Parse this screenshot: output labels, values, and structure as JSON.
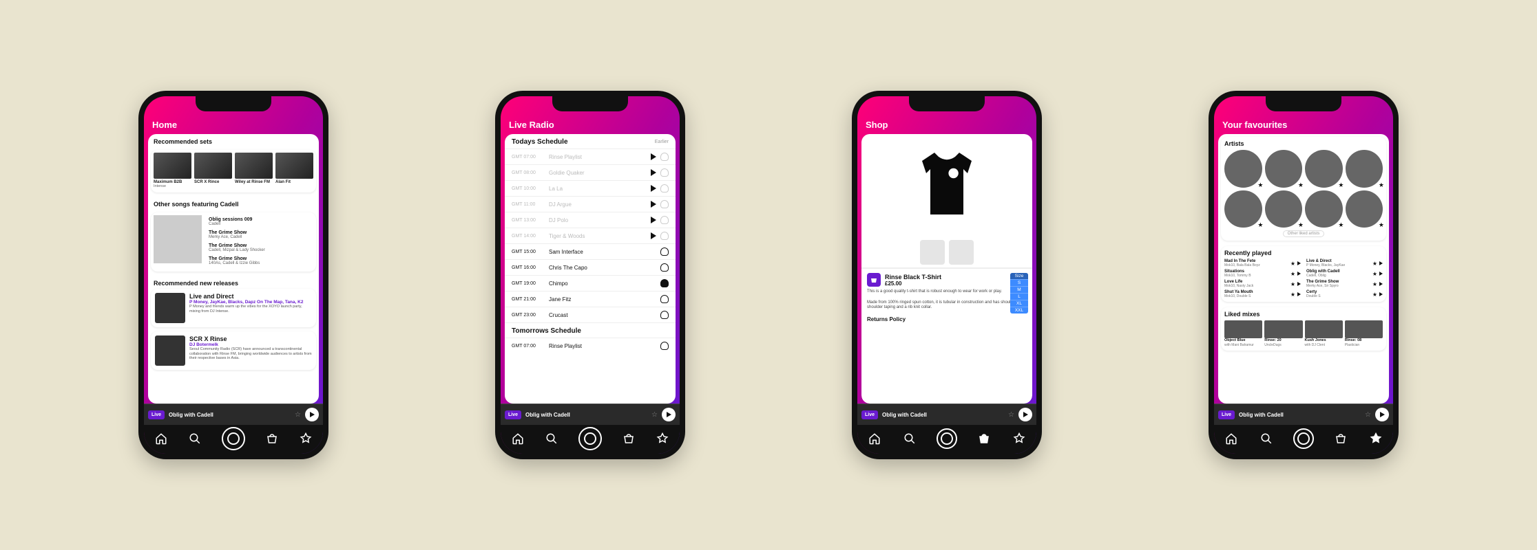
{
  "screens": {
    "home": {
      "title": "Home"
    },
    "radio": {
      "title": "Live Radio"
    },
    "shop": {
      "title": "Shop"
    },
    "favourites": {
      "title": "Your favourites"
    }
  },
  "home": {
    "recommended_heading": "Recommended sets",
    "sets": [
      {
        "label": "Maximum B2B",
        "sub": "Intense"
      },
      {
        "label": "SCR X Rince",
        "sub": ""
      },
      {
        "label": "Wiley at Rinse FM",
        "sub": ""
      },
      {
        "label": "Alan Fit",
        "sub": ""
      }
    ],
    "other_heading": "Other songs featuring Cadell",
    "other": [
      {
        "title": "Oblig sessions 009",
        "sub": "Cadell"
      },
      {
        "title": "The Grime Show",
        "sub": "Merky Ace, Cadell"
      },
      {
        "title": "The Grime Show",
        "sub": "Cadell, Mizpal & Lady Shocker"
      },
      {
        "title": "The Grime Show",
        "sub": "140As, Cadell & Izzie Gibbs"
      }
    ],
    "releases_heading": "Recommended new releases",
    "releases": [
      {
        "title": "Live and Direct",
        "sub": "P Money, JayKae, Blacks, Dapz On The Map, Tana, K2",
        "desc": "P Money and friends warm up the vibes for the XOYO launch party, mixing from DJ Intense."
      },
      {
        "title": "SCR X Rinse",
        "sub": "DJ Botermelk",
        "desc": "Seoul Community Radio (SCR) have announced a transcontinental collaboration with Rinse FM, bringing worldwide audiences to artists from their respective bases in Asia."
      }
    ]
  },
  "radio": {
    "today_heading": "Todays Schedule",
    "earlier_label": "Earlier",
    "tomorrow_heading": "Tomorrows Schedule",
    "today": [
      {
        "time": "GMT 07:00",
        "name": "Rinse Playlist",
        "past": true,
        "play": true
      },
      {
        "time": "GMT 08:00",
        "name": "Goldie Quaker",
        "past": true,
        "play": true
      },
      {
        "time": "GMT 10:00",
        "name": "La La",
        "past": true,
        "play": true
      },
      {
        "time": "GMT 11:00",
        "name": "DJ Argue",
        "past": true,
        "play": true
      },
      {
        "time": "GMT 13:00",
        "name": "DJ Polo",
        "past": true,
        "play": true
      },
      {
        "time": "GMT 14:00",
        "name": "Tiger & Woods",
        "past": true,
        "play": true
      },
      {
        "time": "GMT 15:00",
        "name": "Sam Interface",
        "past": false,
        "play": false
      },
      {
        "time": "GMT 16:00",
        "name": "Chris The Capo",
        "past": false,
        "play": false
      },
      {
        "time": "GMT 19:00",
        "name": "Chimpo",
        "past": false,
        "play": false,
        "bell_filled": true
      },
      {
        "time": "GMT 21:00",
        "name": "Jane Fitz",
        "past": false,
        "play": false
      },
      {
        "time": "GMT 23:00",
        "name": "Crucast",
        "past": false,
        "play": false
      }
    ],
    "tomorrow": [
      {
        "time": "GMT 07:00",
        "name": "Rinse Playlist",
        "past": false,
        "play": false
      }
    ]
  },
  "shop": {
    "name": "Rinse Black T-Shirt",
    "price": "£25.00",
    "sizes_label": "Size",
    "sizes": [
      "S",
      "M",
      "L",
      "XL",
      "XXL"
    ],
    "desc1": "This is a good quality t-shirt that is robust enough to wear for work or play.",
    "desc2": "Made from 100% ringed spun cotton, it is tubular in construction and has shoulder to shoulder taping and a rib knit collar.",
    "policy": "Returns Policy"
  },
  "favourites": {
    "artists_heading": "Artists",
    "other_artists_label": "Other liked artists",
    "artist_count": 8,
    "recently_heading": "Recently played",
    "recent": [
      {
        "t": "Mad In The Fete",
        "s": "Mok10, Bala Bala Boyz"
      },
      {
        "t": "Live & Direct",
        "s": "P Money, Blacks, JayKae"
      },
      {
        "t": "Situations",
        "s": "Mok10, Tommy B"
      },
      {
        "t": "Oblig with Cadell",
        "s": "Cadell, Oblig"
      },
      {
        "t": "Love Life",
        "s": "Mok10, Nasty Jack"
      },
      {
        "t": "The Grime Show",
        "s": "Merky Ace, Sir Spyro"
      },
      {
        "t": "Shut Ya Mouth",
        "s": "Mok10, Double S"
      },
      {
        "t": "Certy",
        "s": "Double S"
      }
    ],
    "liked_heading": "Liked mixes",
    "mixes": [
      {
        "t": "Object Blue",
        "s": "with Mani Bahamur"
      },
      {
        "t": "Rinse: 20",
        "s": "UncleDugs"
      },
      {
        "t": "Kush Jones",
        "s": "with DJ Clent"
      },
      {
        "t": "Rinse: 08",
        "s": "Plastician"
      }
    ]
  },
  "player": {
    "live_label": "Live",
    "now_playing": "Oblig with Cadell"
  }
}
